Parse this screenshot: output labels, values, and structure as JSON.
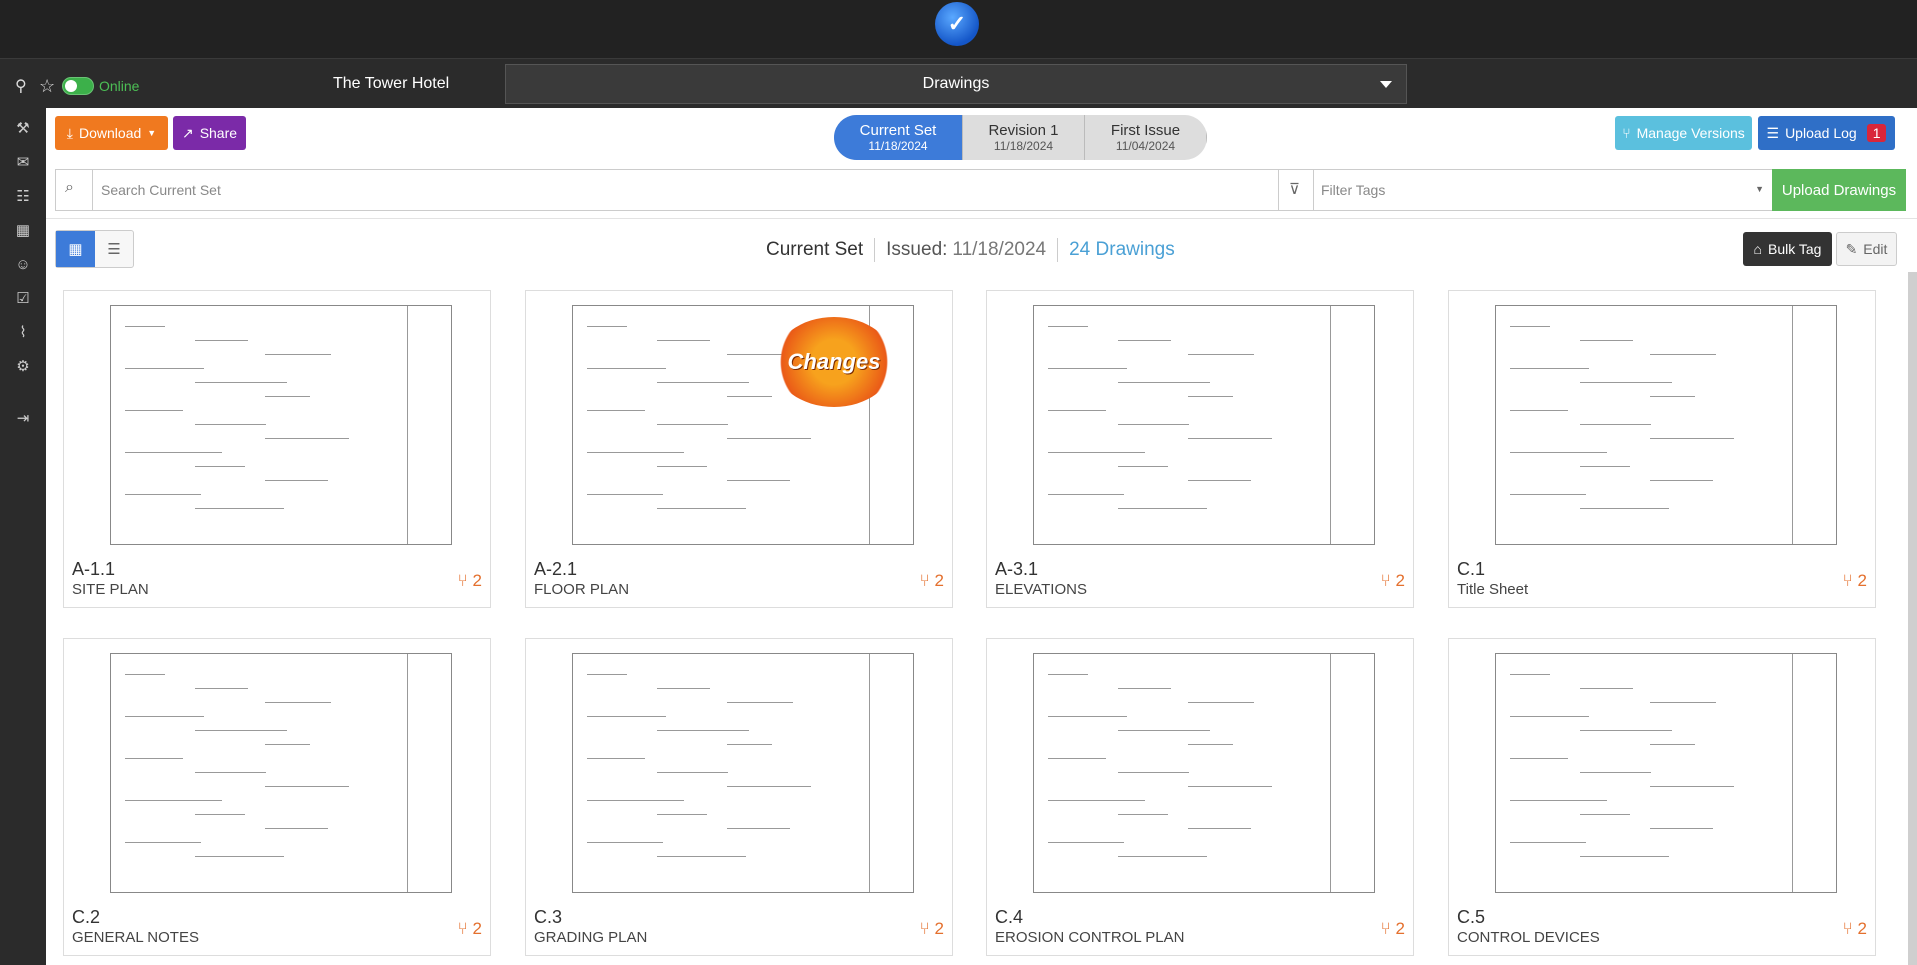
{
  "header": {
    "project": "The Tower Hotel",
    "status": "Online",
    "section": "Drawings"
  },
  "toolbar": {
    "download": "Download",
    "share": "Share",
    "manage_versions": "Manage Versions",
    "upload_log": "Upload Log",
    "upload_log_count": "1"
  },
  "versions": [
    {
      "label": "Current Set",
      "date": "11/18/2024",
      "active": true
    },
    {
      "label": "Revision 1",
      "date": "11/18/2024",
      "active": false
    },
    {
      "label": "First Issue",
      "date": "11/04/2024",
      "active": false
    }
  ],
  "search": {
    "placeholder": "Search Current Set",
    "filter_placeholder": "Filter Tags",
    "upload": "Upload Drawings"
  },
  "setinfo": {
    "title": "Current Set",
    "issued_label": "Issued:",
    "issued_date": "11/18/2024",
    "count": "24 Drawings"
  },
  "actions": {
    "bulk_tag": "Bulk Tag",
    "edit": "Edit"
  },
  "drawings": [
    {
      "code": "A-1.1",
      "name": "SITE PLAN",
      "versions": "2"
    },
    {
      "code": "A-2.1",
      "name": "FLOOR PLAN",
      "versions": "2",
      "badge": "Changes"
    },
    {
      "code": "A-3.1",
      "name": "ELEVATIONS",
      "versions": "2"
    },
    {
      "code": "C.1",
      "name": "Title Sheet",
      "versions": "2"
    },
    {
      "code": "C.2",
      "name": "GENERAL NOTES",
      "versions": "2"
    },
    {
      "code": "C.3",
      "name": "GRADING PLAN",
      "versions": "2"
    },
    {
      "code": "C.4",
      "name": "EROSION CONTROL PLAN",
      "versions": "2"
    },
    {
      "code": "C.5",
      "name": "CONTROL DEVICES",
      "versions": "2"
    }
  ],
  "colors": {
    "accent": "#3d7bd9",
    "download": "#f0791f",
    "share": "#7b2aa8",
    "upload": "#5cb85c",
    "version_icon": "#e4702e"
  }
}
